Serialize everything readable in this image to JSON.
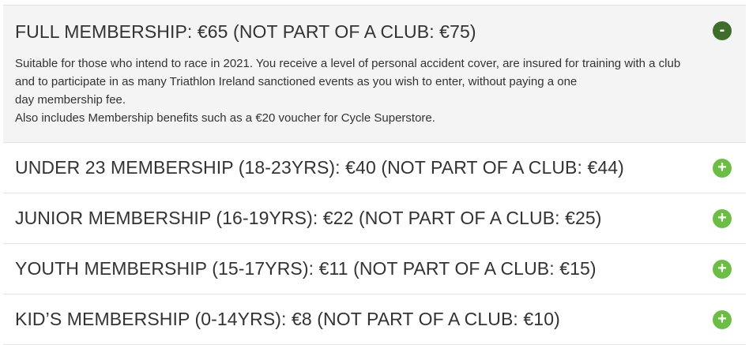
{
  "memberships": [
    {
      "title": "FULL MEMBERSHIP: €65 (NOT PART OF A CLUB: €75)",
      "expanded": true,
      "toggle_symbol": "-",
      "description_lines": [
        "Suitable for those who intend to race in 2021. You receive a level of personal accident cover, are insured for training with a club",
        "and to participate in as many Triathlon Ireland sanctioned events as you wish to enter, without paying a one",
        "day membership fee."
      ],
      "benefits": "Also includes Membership benefits such as a €20 voucher for Cycle Superstore."
    },
    {
      "title": "UNDER 23 MEMBERSHIP (18-23YRS): €40 (NOT PART OF A CLUB: €44)",
      "expanded": false,
      "toggle_symbol": "+"
    },
    {
      "title": "JUNIOR MEMBERSHIP (16-19YRS): €22 (NOT PART OF A CLUB: €25)",
      "expanded": false,
      "toggle_symbol": "+"
    },
    {
      "title": "YOUTH MEMBERSHIP (15-17YRS): €11 (NOT PART OF A CLUB: €15)",
      "expanded": false,
      "toggle_symbol": "+"
    },
    {
      "title": "KID’S MEMBERSHIP (0-14YRS): €8 (NOT PART OF A CLUB: €10)",
      "expanded": false,
      "toggle_symbol": "+"
    }
  ],
  "colors": {
    "open_toggle": "#3f6e2c",
    "closed_toggle": "#6cbd45",
    "open_panel_bg": "#f4f4f4"
  },
  "icons": {
    "open": "minus-icon",
    "closed": "plus-icon"
  }
}
